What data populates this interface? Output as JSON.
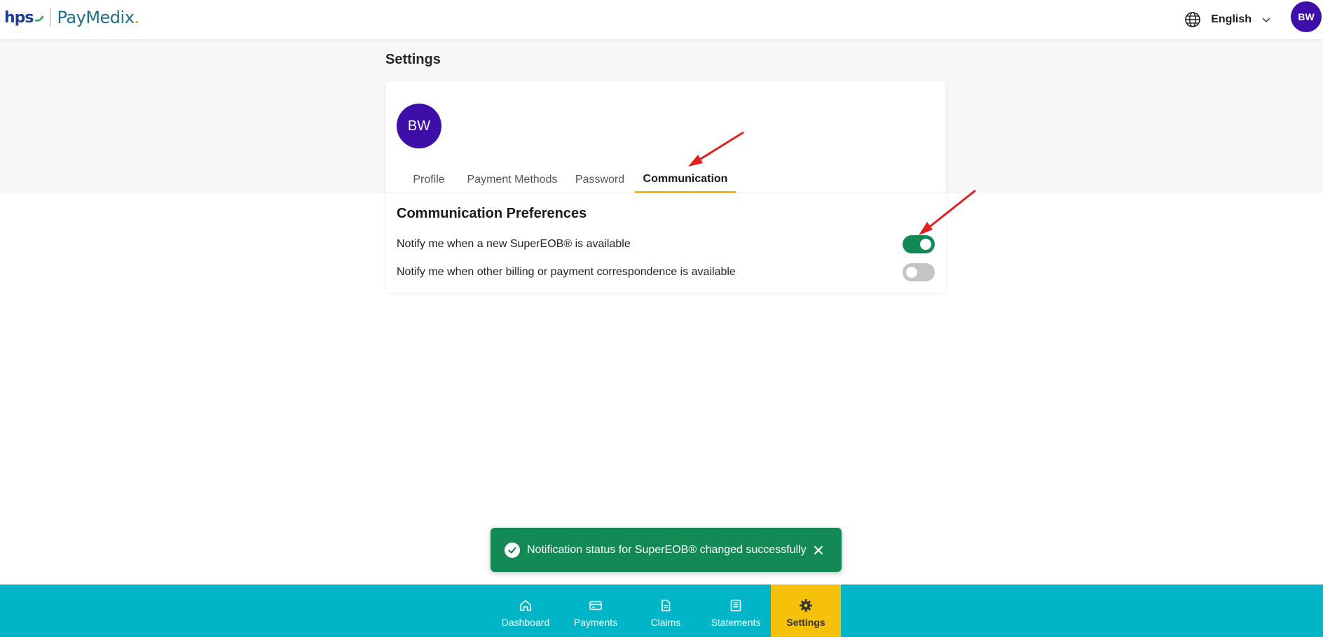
{
  "header": {
    "logo_hps": "hps",
    "logo_paymedix": "PayMedix",
    "logo_x": ".",
    "language": "English",
    "avatar_initials": "BW"
  },
  "page": {
    "title": "Settings"
  },
  "card": {
    "avatar_initials": "BW",
    "tabs": [
      {
        "label": "Profile",
        "active": false
      },
      {
        "label": "Payment Methods",
        "active": false
      },
      {
        "label": "Password",
        "active": false
      },
      {
        "label": "Communication",
        "active": true
      }
    ]
  },
  "preferences": {
    "title": "Communication Preferences",
    "items": [
      {
        "label": "Notify me when a new SuperEOB® is available",
        "enabled": true
      },
      {
        "label": "Notify me when other billing or payment correspondence is available",
        "enabled": false
      }
    ]
  },
  "toast": {
    "message": "Notification status for SuperEOB® changed successfully"
  },
  "bottom_nav": {
    "items": [
      {
        "label": "Dashboard",
        "icon": "home-icon",
        "active": false
      },
      {
        "label": "Payments",
        "icon": "card-icon",
        "active": false
      },
      {
        "label": "Claims",
        "icon": "document-icon",
        "active": false
      },
      {
        "label": "Statements",
        "icon": "statement-icon",
        "active": false
      },
      {
        "label": "Settings",
        "icon": "gear-icon",
        "active": true
      }
    ]
  },
  "colors": {
    "brand_purple": "#3d0ea8",
    "nav_teal": "#00b5c8",
    "nav_active_yellow": "#f5c10b",
    "success_green": "#138a55",
    "tab_underline": "#f4b400",
    "annotation_red": "#e31e1e"
  }
}
